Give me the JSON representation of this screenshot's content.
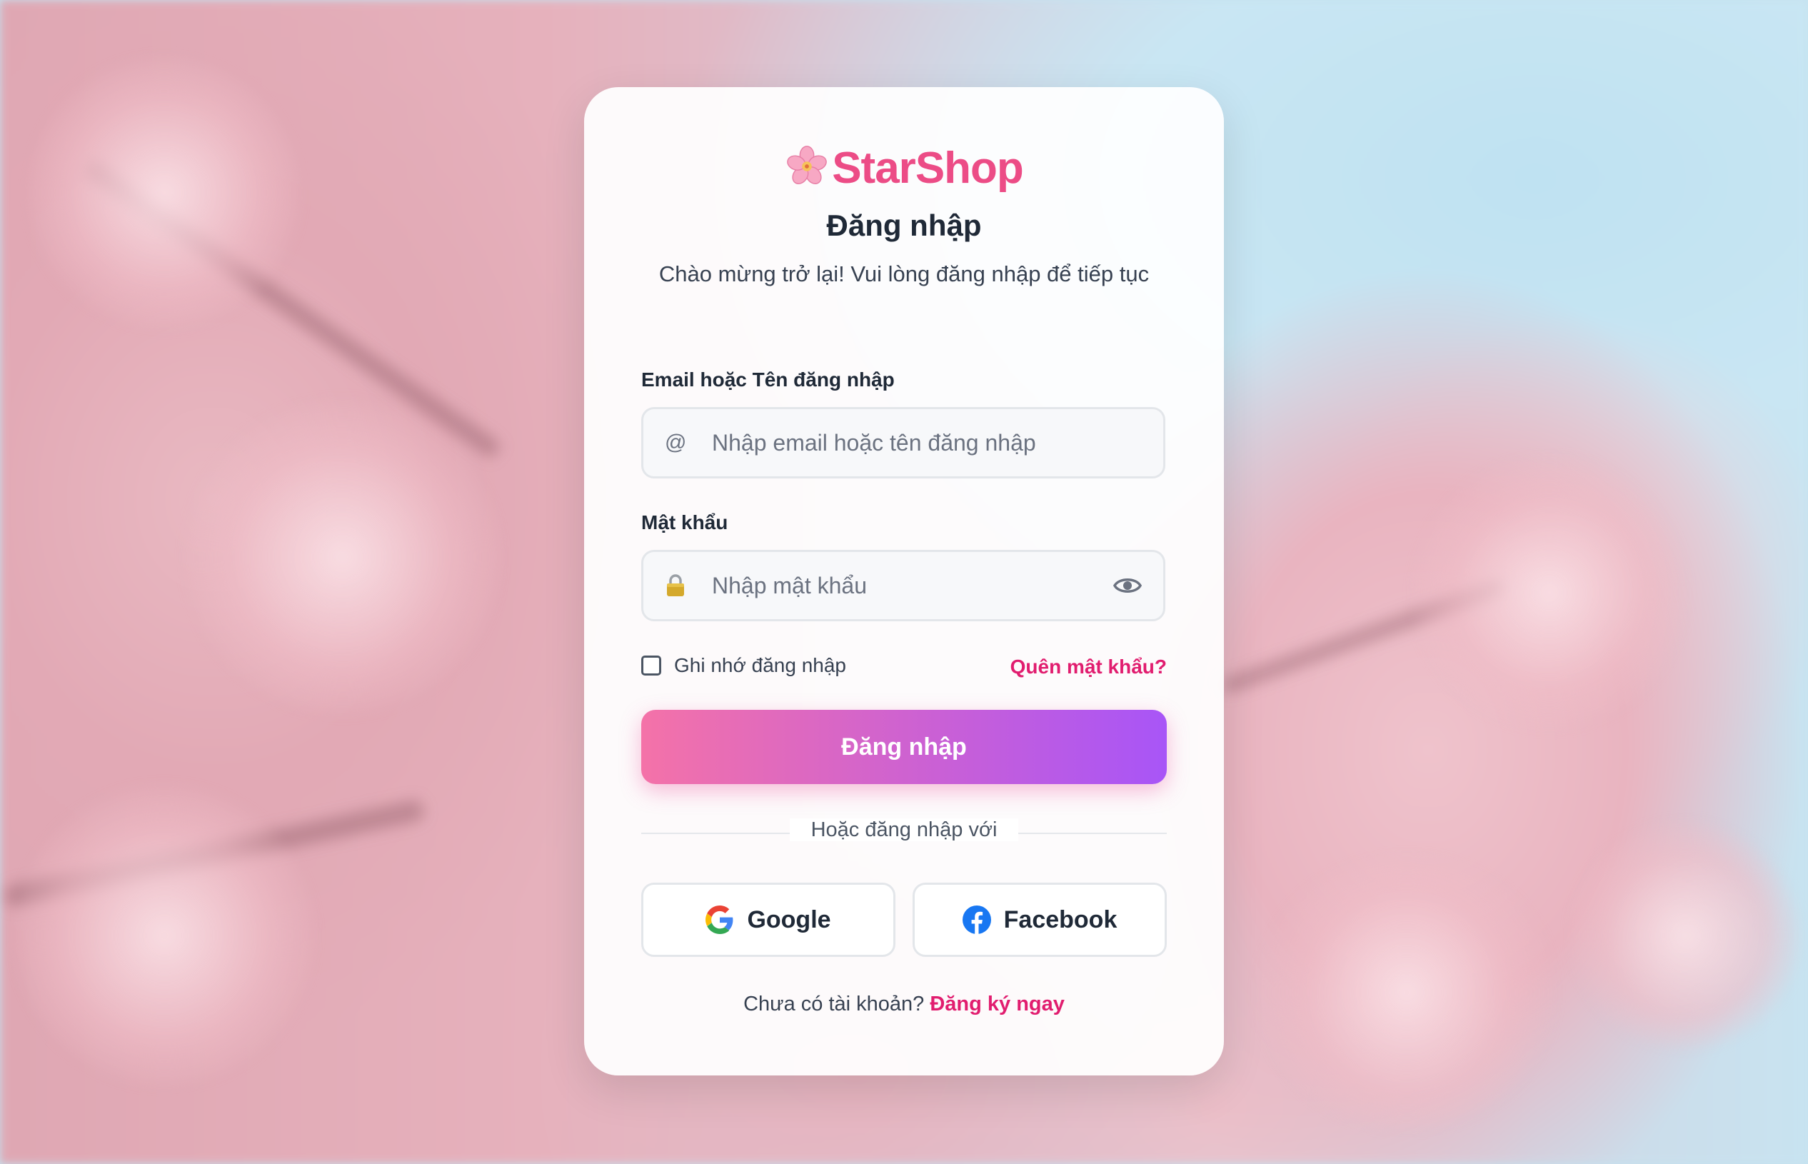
{
  "brand": {
    "name": "StarShop",
    "color": "#ec4c86"
  },
  "heading": {
    "title": "Đăng nhập",
    "subtitle": "Chào mừng trở lại! Vui lòng đăng nhập để tiếp tục"
  },
  "form": {
    "username": {
      "label": "Email hoặc Tên đăng nhập",
      "placeholder": "Nhập email hoặc tên đăng nhập",
      "icon": "at-icon",
      "icon_glyph": "@"
    },
    "password": {
      "label": "Mật khẩu",
      "placeholder": "Nhập mật khẩu",
      "icon": "lock-icon",
      "toggle_icon": "eye-icon"
    },
    "remember_label": "Ghi nhớ đăng nhập",
    "remember_checked": false,
    "forgot_label": "Quên mật khẩu?",
    "submit_label": "Đăng nhập"
  },
  "social": {
    "divider_text": "Hoặc đăng nhập với",
    "google_label": "Google",
    "facebook_label": "Facebook"
  },
  "footer": {
    "prompt": "Chưa có tài khoản?",
    "signup_link": "Đăng ký ngay"
  },
  "colors": {
    "accent": "#e11d6f",
    "gradient_start": "#f472a8",
    "gradient_end": "#a855f7"
  }
}
